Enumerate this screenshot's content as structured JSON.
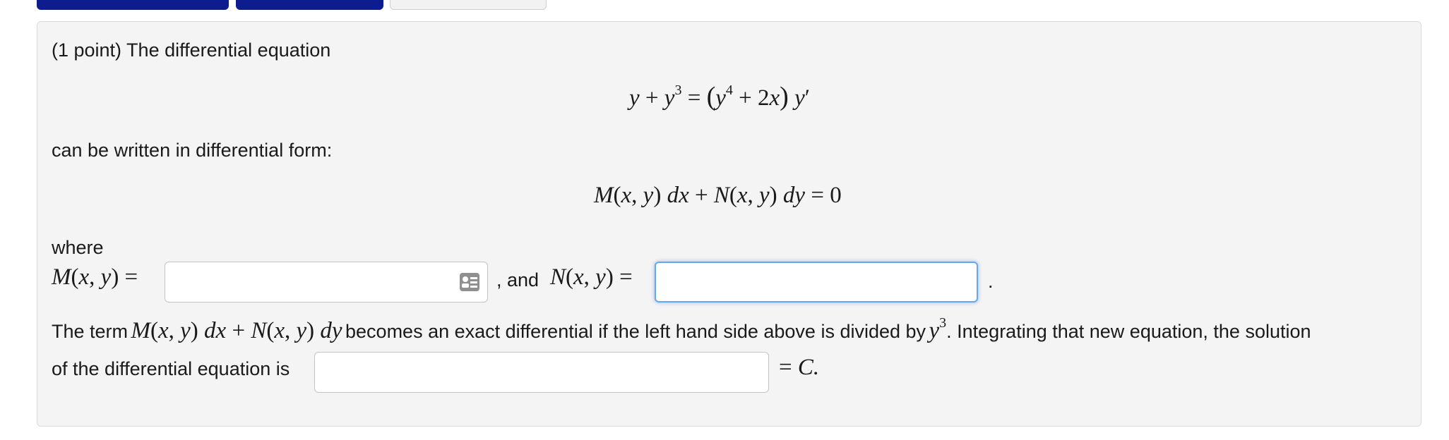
{
  "problem": {
    "intro": "(1 point) The differential equation",
    "written_in_form": "can be written in differential form:",
    "where": "where",
    "and_label": ", and",
    "period": ".",
    "term_text_1": "The term",
    "term_text_2": "becomes an exact differential if the left hand side above is divided by",
    "term_text_3": ". Integrating that new equation, the solution",
    "solution_line": "of the differential equation is",
    "equals_c": "= C."
  },
  "inputs": {
    "m_value": "",
    "n_value": "",
    "solution_value": ""
  },
  "icons": {
    "equation_editor": "equation-editor-icon"
  },
  "colors": {
    "tab_active": "#0d1c8f",
    "focus_ring": "#68a7ea",
    "panel_bg": "#f4f4f4"
  }
}
